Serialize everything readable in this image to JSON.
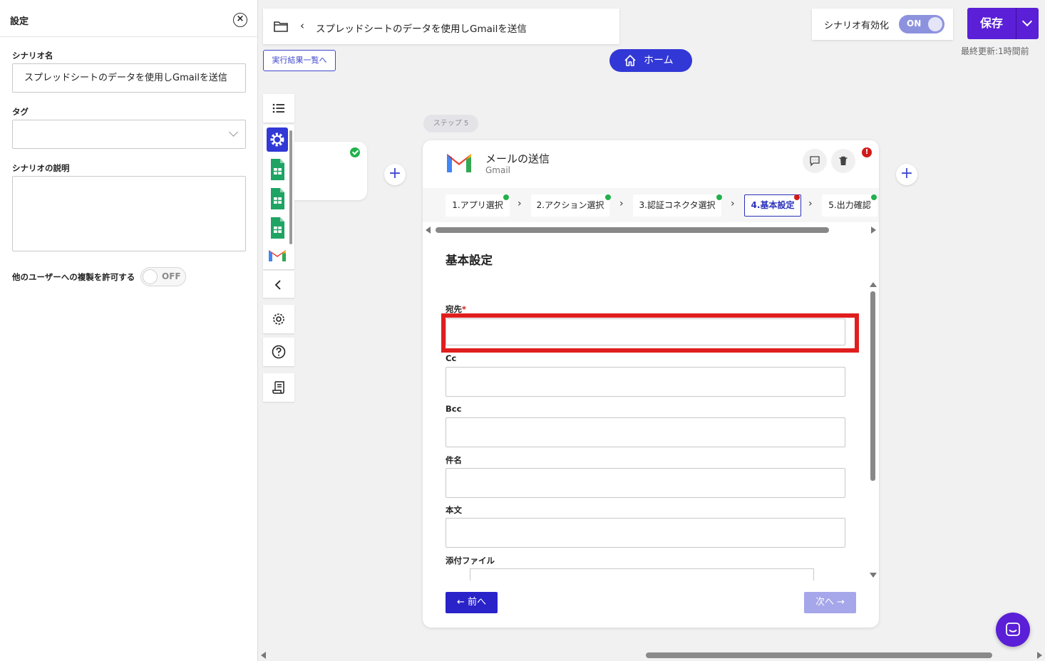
{
  "settings_panel": {
    "title": "設定",
    "scenario_name_label": "シナリオ名",
    "scenario_name_value": "スプレッドシートのデータを使用しGmailを送信",
    "tag_label": "タグ",
    "tag_value": "",
    "description_label": "シナリオの説明",
    "description_value": "",
    "allow_copy_label": "他のユーザーへの複製を許可する",
    "allow_copy_toggle": "OFF"
  },
  "header": {
    "scenario_title": "スプレッドシートのデータを使用しGmailを送信",
    "results_link": "実行結果一覧へ",
    "home_label": "ホーム",
    "enable_label": "シナリオ有効化",
    "enable_toggle": "ON",
    "save_label": "保存",
    "last_updated": "最終更新:1時間前"
  },
  "step_badge": "ステップ 5",
  "step_card": {
    "title": "メールの送信",
    "app": "Gmail",
    "tabs": [
      {
        "label": "1.アプリ選択",
        "status": "done"
      },
      {
        "label": "2.アクション選択",
        "status": "done"
      },
      {
        "label": "3.認証コネクタ選択",
        "status": "done"
      },
      {
        "label": "4.基本設定",
        "status": "error"
      },
      {
        "label": "5.出力確認",
        "status": "done"
      }
    ],
    "section_title": "基本設定",
    "fields": [
      {
        "label": "宛先",
        "required": true,
        "value": ""
      },
      {
        "label": "Cc",
        "required": false,
        "value": ""
      },
      {
        "label": "Bcc",
        "required": false,
        "value": ""
      },
      {
        "label": "件名",
        "required": false,
        "value": ""
      },
      {
        "label": "本文",
        "required": false,
        "value": ""
      },
      {
        "label": "添付ファイル",
        "required": false,
        "value": ""
      }
    ],
    "prev_label": "← 前へ",
    "next_label": "次へ →"
  },
  "colors": {
    "primary": "#3238d6",
    "save": "#5a1fd6",
    "success": "#22b14c",
    "error": "#d11a1a",
    "highlight": "#e01e1e"
  },
  "icons": [
    "close-icon",
    "folder-icon",
    "back-chevron-icon",
    "home-icon",
    "list-icon",
    "gear-icon",
    "google-sheets-icon",
    "gmail-icon",
    "help-icon",
    "log-icon",
    "comment-icon",
    "trash-icon",
    "plus-icon",
    "chat-icon"
  ]
}
